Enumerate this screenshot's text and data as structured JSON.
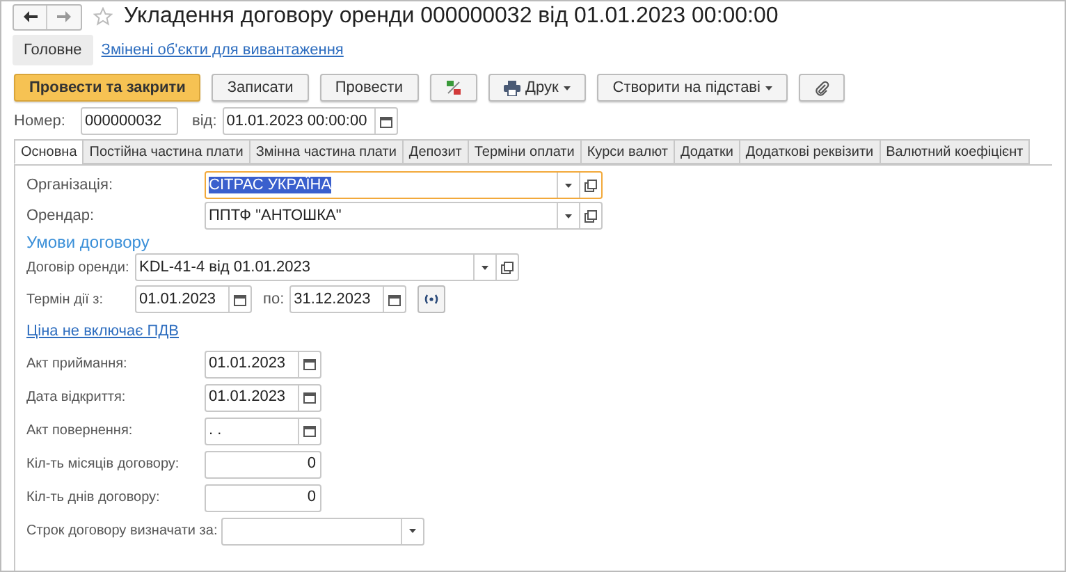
{
  "window": {
    "title": "Укладення договору оренди 000000032 від 01.01.2023 00:00:00",
    "favorite": false
  },
  "nav": [
    {
      "label": "Головне",
      "selected": true
    },
    {
      "label": "Змінені об'єкти для вивантаження",
      "selected": false
    }
  ],
  "toolbar": [
    {
      "kind": "primary",
      "label": "Провести та закрити"
    },
    {
      "kind": "button",
      "label": "Записати"
    },
    {
      "kind": "button",
      "label": "Провести"
    },
    {
      "kind": "dtkt"
    },
    {
      "kind": "print",
      "label": "Друк"
    },
    {
      "kind": "menu",
      "label": "Створити на підставі"
    },
    {
      "kind": "clip"
    }
  ],
  "number": {
    "label": "Номер:",
    "value": "000000032",
    "date_label": "від:",
    "date_value": "01.01.2023 00:00:00"
  },
  "tabs": [
    {
      "label": "Основна",
      "selected": true
    },
    {
      "label": "Постійна частина плати",
      "selected": false
    },
    {
      "label": "Змінна частина плати",
      "selected": false
    },
    {
      "label": "Депозит",
      "selected": false
    },
    {
      "label": "Терміни оплати",
      "selected": false
    },
    {
      "label": "Курси валют",
      "selected": false
    },
    {
      "label": "Додатки",
      "selected": false
    },
    {
      "label": "Додаткові реквізити",
      "selected": false
    },
    {
      "label": "Валютний коефіцієнт",
      "selected": false
    }
  ],
  "parties": [
    {
      "label": "Організація:",
      "value": "СІТРАС УКРАЇНА",
      "focused": true
    },
    {
      "label": "Орендар:",
      "value": "ППТФ \"АНТОШКА\"",
      "focused": false
    }
  ],
  "section_title": "Умови договору",
  "contract": {
    "label": "Договір оренди:",
    "value": "KDL-41-4 від 01.01.2023"
  },
  "period": {
    "label": "Термін дії з:",
    "from": "01.01.2023",
    "to_label": "по:",
    "to": "31.12.2023"
  },
  "vat_link": "Ціна не включає ПДВ",
  "details": [
    {
      "kind": "date",
      "label": "Акт приймання:",
      "value": "01.01.2023"
    },
    {
      "kind": "date",
      "label": "Дата відкриття:",
      "value": "01.01.2023"
    },
    {
      "kind": "date",
      "label": "Акт повернення:",
      "value": ". ."
    },
    {
      "kind": "number",
      "label": "Кіл-ть місяців договору:",
      "value": "0"
    },
    {
      "kind": "number",
      "label": "Кіл-ть днів договору:",
      "value": "0"
    },
    {
      "kind": "select",
      "label": "Строк договору визначати за:"
    }
  ]
}
